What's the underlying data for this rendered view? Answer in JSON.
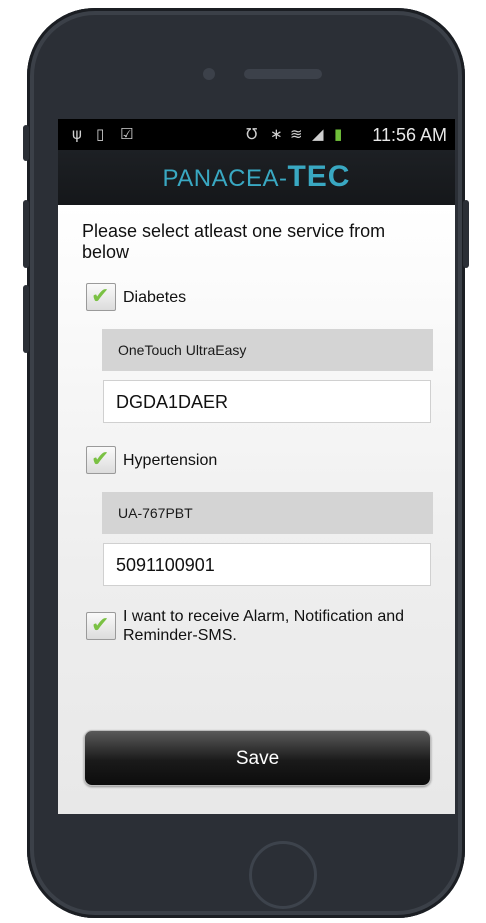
{
  "status_bar": {
    "left_icons": [
      "usb-icon",
      "sim-icon",
      "clipboard-check-icon"
    ],
    "right_icons": [
      "vibrate-icon",
      "bluetooth-icon",
      "wifi-icon",
      "signal-icon",
      "battery-charging-icon"
    ],
    "usb_glyph": "ψ",
    "sim_glyph": "▯",
    "clip_glyph": "☑",
    "vibrate_glyph": "℧",
    "bluetooth_glyph": "∗",
    "wifi_glyph": "≋",
    "signal_glyph": "◢",
    "battery_glyph": "▮",
    "time": "11:56 AM"
  },
  "header": {
    "logo_part1": "PANACEA-",
    "logo_part2": "TEC",
    "logo_color": "#39a8c2"
  },
  "form": {
    "instruction": "Please select atleast one service from below",
    "check_glyph": "✔",
    "services": [
      {
        "label": "Diabetes",
        "checked": true,
        "device": "OneTouch UltraEasy",
        "value": "DGDA1DAER"
      },
      {
        "label": "Hypertension",
        "checked": true,
        "device": "UA-767PBT",
        "value": "5091100901"
      }
    ],
    "sms_optin": {
      "label": "I want to receive Alarm, Notification and Reminder-SMS.",
      "checked": true
    },
    "save_label": "Save"
  },
  "colors": {
    "accent_check": "#7ac143",
    "status_bar_bg": "#000000",
    "device_bg": "#d4d4d4"
  }
}
